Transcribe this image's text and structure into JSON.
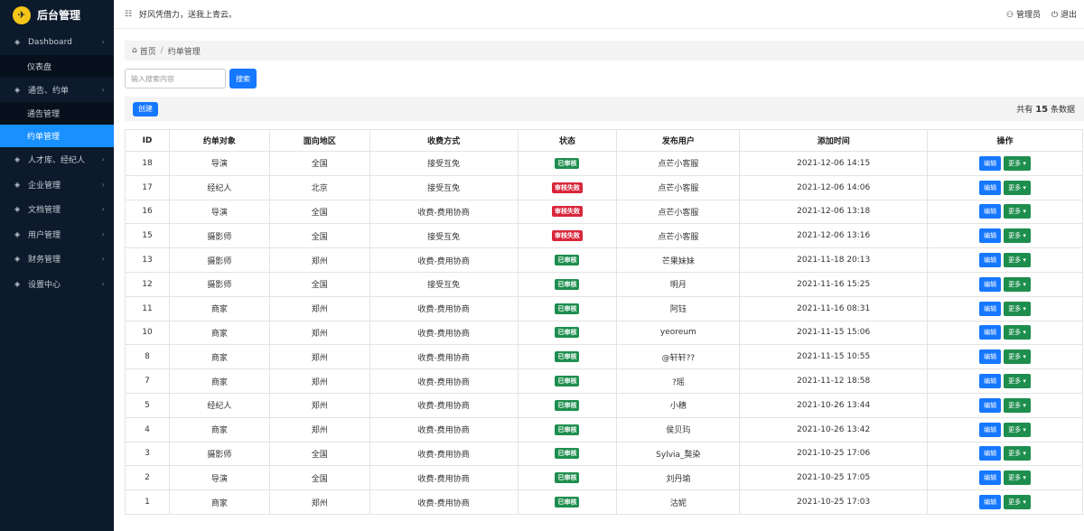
{
  "app": {
    "title": "后台管理",
    "logo_icon": "rocket-icon"
  },
  "sidebar": {
    "items": [
      {
        "label": "Dashboard",
        "icon": "layers-icon",
        "type": "group"
      },
      {
        "label": "仪表盘",
        "type": "sub"
      },
      {
        "label": "通告、约单",
        "icon": "layers-icon",
        "type": "group"
      },
      {
        "label": "通告管理",
        "type": "sub"
      },
      {
        "label": "约单管理",
        "type": "sub",
        "active": true
      },
      {
        "label": "人才库、经纪人",
        "icon": "layers-icon",
        "type": "group"
      },
      {
        "label": "企业管理",
        "icon": "layers-icon",
        "type": "group"
      },
      {
        "label": "文档管理",
        "icon": "layers-icon",
        "type": "group"
      },
      {
        "label": "用户管理",
        "icon": "layers-icon",
        "type": "group"
      },
      {
        "label": "财务管理",
        "icon": "layers-icon",
        "type": "group"
      },
      {
        "label": "设置中心",
        "icon": "layers-icon",
        "type": "group"
      }
    ]
  },
  "topbar": {
    "motto": "好风凭借力，送我上青云。",
    "admin": "管理员",
    "logout": "退出"
  },
  "breadcrumb": {
    "home": "首页",
    "current": "约单管理"
  },
  "search": {
    "placeholder": "输入搜索内容",
    "button": "搜索"
  },
  "toolbar": {
    "create": "创建",
    "total_prefix": "共有",
    "total_count": "15",
    "total_suffix": "条数据"
  },
  "table": {
    "headers": [
      "ID",
      "约单对象",
      "面向地区",
      "收费方式",
      "状态",
      "发布用户",
      "添加时间",
      "操作"
    ],
    "edit_label": "编辑",
    "more_label": "更多",
    "rows": [
      {
        "id": "18",
        "target": "导演",
        "region": "全国",
        "fee": "接受互免",
        "status": "已审核",
        "status_type": "ok",
        "user": "点芒小客服",
        "time": "2021-12-06 14:15"
      },
      {
        "id": "17",
        "target": "经纪人",
        "region": "北京",
        "fee": "接受互免",
        "status": "审核失败",
        "status_type": "fail",
        "user": "点芒小客服",
        "time": "2021-12-06 14:06"
      },
      {
        "id": "16",
        "target": "导演",
        "region": "全国",
        "fee": "收费-费用协商",
        "status": "审核失败",
        "status_type": "fail",
        "user": "点芒小客服",
        "time": "2021-12-06 13:18"
      },
      {
        "id": "15",
        "target": "摄影师",
        "region": "全国",
        "fee": "接受互免",
        "status": "审核失败",
        "status_type": "fail",
        "user": "点芒小客服",
        "time": "2021-12-06 13:16"
      },
      {
        "id": "13",
        "target": "摄影师",
        "region": "郑州",
        "fee": "收费-费用协商",
        "status": "已审核",
        "status_type": "ok",
        "user": "芒果妹妹",
        "time": "2021-11-18 20:13"
      },
      {
        "id": "12",
        "target": "摄影师",
        "region": "全国",
        "fee": "接受互免",
        "status": "已审核",
        "status_type": "ok",
        "user": "明月",
        "time": "2021-11-16 15:25"
      },
      {
        "id": "11",
        "target": "商家",
        "region": "郑州",
        "fee": "收费-费用协商",
        "status": "已审核",
        "status_type": "ok",
        "user": "阿钰",
        "time": "2021-11-16 08:31"
      },
      {
        "id": "10",
        "target": "商家",
        "region": "郑州",
        "fee": "收费-费用协商",
        "status": "已审核",
        "status_type": "ok",
        "user": "yeoreum",
        "time": "2021-11-15 15:06"
      },
      {
        "id": "8",
        "target": "商家",
        "region": "郑州",
        "fee": "收费-费用协商",
        "status": "已审核",
        "status_type": "ok",
        "user": "@轩轩??",
        "time": "2021-11-15 10:55"
      },
      {
        "id": "7",
        "target": "商家",
        "region": "郑州",
        "fee": "收费-费用协商",
        "status": "已审核",
        "status_type": "ok",
        "user": "?瑶",
        "time": "2021-11-12 18:58"
      },
      {
        "id": "5",
        "target": "经纪人",
        "region": "郑州",
        "fee": "收费-费用协商",
        "status": "已审核",
        "status_type": "ok",
        "user": "小穗",
        "time": "2021-10-26 13:44"
      },
      {
        "id": "4",
        "target": "商家",
        "region": "郑州",
        "fee": "收费-费用协商",
        "status": "已审核",
        "status_type": "ok",
        "user": "侯贝玙",
        "time": "2021-10-26 13:42"
      },
      {
        "id": "3",
        "target": "摄影师",
        "region": "全国",
        "fee": "收费-费用协商",
        "status": "已审核",
        "status_type": "ok",
        "user": "Sylvia_獒染",
        "time": "2021-10-25 17:06"
      },
      {
        "id": "2",
        "target": "导演",
        "region": "全国",
        "fee": "收费-费用协商",
        "status": "已审核",
        "status_type": "ok",
        "user": "刘丹瑜",
        "time": "2021-10-25 17:05"
      },
      {
        "id": "1",
        "target": "商家",
        "region": "郑州",
        "fee": "收费-费用协商",
        "status": "已审核",
        "status_type": "ok",
        "user": "沽妮",
        "time": "2021-10-25 17:03"
      }
    ]
  }
}
